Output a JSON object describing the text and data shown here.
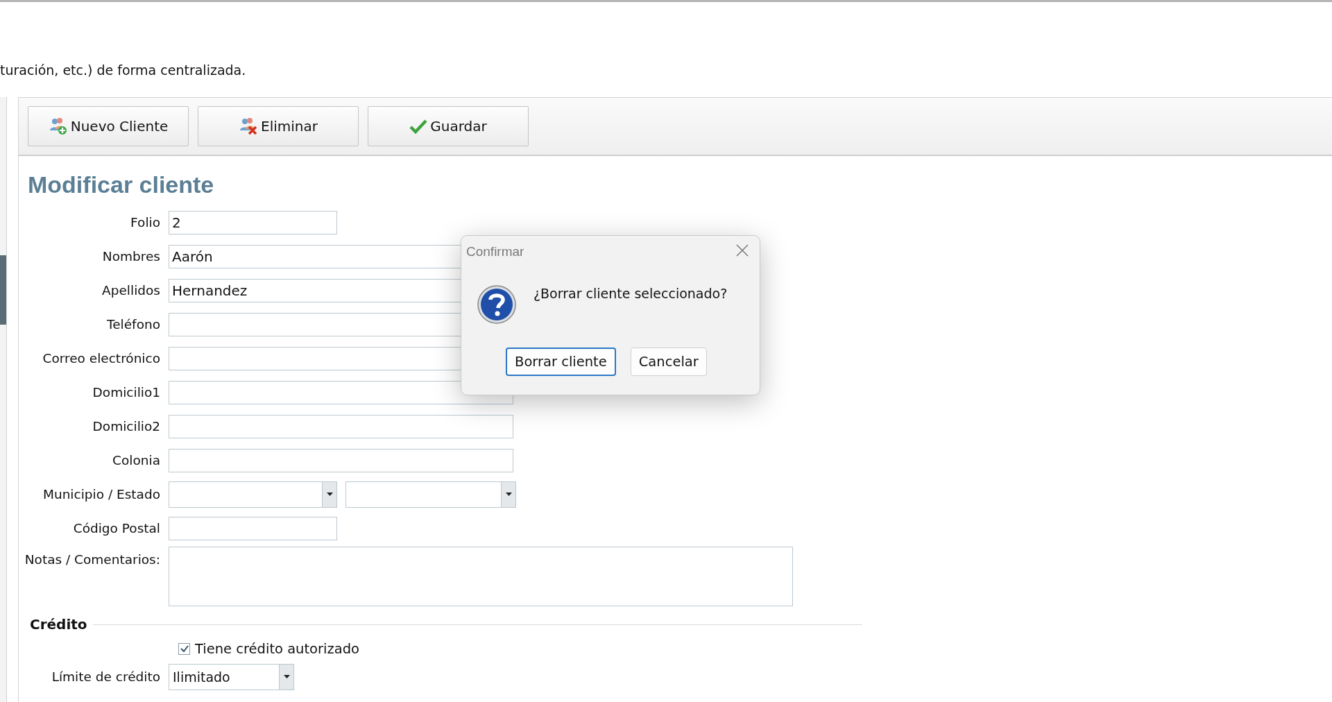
{
  "description": "turación, etc.) de forma centralizada.",
  "toolbar": [
    {
      "label": "Nuevo Cliente",
      "kind": "add"
    },
    {
      "label": "Eliminar",
      "kind": "delete"
    },
    {
      "label": "Guardar",
      "kind": "save"
    }
  ],
  "form": {
    "title": "Modificar cliente",
    "fields": [
      {
        "label": "Folio",
        "kind": "short",
        "value": "2"
      },
      {
        "label": "Nombres",
        "kind": "text",
        "value": "Aarón"
      },
      {
        "label": "Apellidos",
        "kind": "text",
        "value": "Hernandez"
      },
      {
        "label": "Teléfono",
        "kind": "text"
      },
      {
        "label": "Correo electrónico",
        "kind": "text"
      },
      {
        "label": "Domicilio1",
        "kind": "text"
      },
      {
        "label": "Domicilio2",
        "kind": "text"
      },
      {
        "label": "Colonia",
        "kind": "text"
      },
      {
        "label": "Municipio / Estado",
        "kind": "combo-pair"
      },
      {
        "label": "Código Postal",
        "kind": "short"
      },
      {
        "label": "Notas / Comentarios:",
        "kind": "textarea"
      }
    ]
  },
  "credit": {
    "title": "Crédito",
    "authorized": {
      "label": "Tiene crédito autorizado",
      "checked": true
    },
    "limit": {
      "label": "Límite de crédito",
      "value": "Ilimitado"
    }
  },
  "dialog": {
    "title": "Confirmar",
    "message": "¿Borrar cliente seleccionado?",
    "buttons": [
      {
        "label": "Borrar cliente",
        "default": true
      },
      {
        "label": "Cancelar",
        "default": false
      }
    ]
  }
}
